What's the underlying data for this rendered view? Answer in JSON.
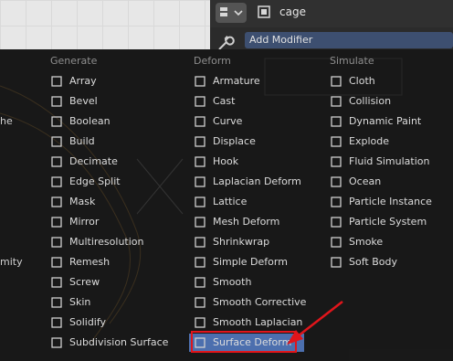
{
  "window": {
    "object_name": "cage",
    "add_modifier_label": "Add Modifier"
  },
  "background_fragments": [
    "he",
    "mity"
  ],
  "columns": [
    {
      "header": "Generate",
      "items": [
        {
          "label": "Array",
          "icon": "array-icon"
        },
        {
          "label": "Bevel",
          "icon": "bevel-icon"
        },
        {
          "label": "Boolean",
          "icon": "boolean-icon"
        },
        {
          "label": "Build",
          "icon": "build-icon"
        },
        {
          "label": "Decimate",
          "icon": "decimate-icon"
        },
        {
          "label": "Edge Split",
          "icon": "edge-split-icon"
        },
        {
          "label": "Mask",
          "icon": "mask-icon"
        },
        {
          "label": "Mirror",
          "icon": "mirror-icon"
        },
        {
          "label": "Multiresolution",
          "icon": "multiresolution-icon"
        },
        {
          "label": "Remesh",
          "icon": "remesh-icon"
        },
        {
          "label": "Screw",
          "icon": "screw-icon"
        },
        {
          "label": "Skin",
          "icon": "skin-icon"
        },
        {
          "label": "Solidify",
          "icon": "solidify-icon"
        },
        {
          "label": "Subdivision Surface",
          "icon": "subdivision-surface-icon"
        }
      ]
    },
    {
      "header": "Deform",
      "items": [
        {
          "label": "Armature",
          "icon": "armature-icon"
        },
        {
          "label": "Cast",
          "icon": "cast-icon"
        },
        {
          "label": "Curve",
          "icon": "curve-icon"
        },
        {
          "label": "Displace",
          "icon": "displace-icon"
        },
        {
          "label": "Hook",
          "icon": "hook-icon"
        },
        {
          "label": "Laplacian Deform",
          "icon": "laplacian-deform-icon"
        },
        {
          "label": "Lattice",
          "icon": "lattice-icon"
        },
        {
          "label": "Mesh Deform",
          "icon": "mesh-deform-icon"
        },
        {
          "label": "Shrinkwrap",
          "icon": "shrinkwrap-icon"
        },
        {
          "label": "Simple Deform",
          "icon": "simple-deform-icon"
        },
        {
          "label": "Smooth",
          "icon": "smooth-icon"
        },
        {
          "label": "Smooth Corrective",
          "icon": "smooth-corrective-icon"
        },
        {
          "label": "Smooth Laplacian",
          "icon": "smooth-laplacian-icon"
        },
        {
          "label": "Surface Deform",
          "icon": "surface-deform-icon",
          "selected": true
        }
      ]
    },
    {
      "header": "Simulate",
      "items": [
        {
          "label": "Cloth",
          "icon": "cloth-icon"
        },
        {
          "label": "Collision",
          "icon": "collision-icon"
        },
        {
          "label": "Dynamic Paint",
          "icon": "dynamic-paint-icon"
        },
        {
          "label": "Explode",
          "icon": "explode-icon"
        },
        {
          "label": "Fluid Simulation",
          "icon": "fluid-simulation-icon"
        },
        {
          "label": "Ocean",
          "icon": "ocean-icon"
        },
        {
          "label": "Particle Instance",
          "icon": "particle-instance-icon"
        },
        {
          "label": "Particle System",
          "icon": "particle-system-icon"
        },
        {
          "label": "Smoke",
          "icon": "smoke-icon"
        },
        {
          "label": "Soft Body",
          "icon": "soft-body-icon"
        }
      ]
    }
  ],
  "colors": {
    "selected_bg": "#4c6fae",
    "annotation": "#e0151b",
    "add_modifier_bg": "#3d4f70"
  }
}
